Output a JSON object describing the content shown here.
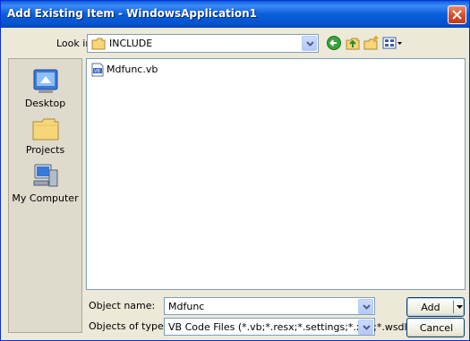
{
  "window": {
    "title": "Add Existing Item - WindowsApplication1"
  },
  "look_in": {
    "label": "Look in:",
    "value": "INCLUDE"
  },
  "places": [
    {
      "label": "Desktop"
    },
    {
      "label": "Projects"
    },
    {
      "label": "My Computer"
    }
  ],
  "files": [
    {
      "name": "Mdfunc.vb",
      "selected": false
    }
  ],
  "object_name": {
    "label": "Object name:",
    "value": "Mdfunc"
  },
  "object_type": {
    "label": "Objects of type:",
    "value": "VB Code Files (*.vb;*.resx;*.settings;*.xsd;*.wsdl)"
  },
  "buttons": {
    "add": "Add",
    "cancel": "Cancel"
  },
  "colors": {
    "title_bar": "#0a5fd9",
    "close": "#d3472a",
    "panel": "#ece9d8"
  }
}
